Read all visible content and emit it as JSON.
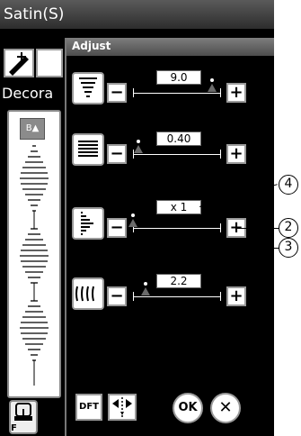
{
  "window": {
    "title": "Satin(S)"
  },
  "background": {
    "side_label": "Decora"
  },
  "panel": {
    "title": "Adjust",
    "rows": [
      {
        "name": "width",
        "value": "9.0",
        "position": 0.9
      },
      {
        "name": "density",
        "value": "0.40",
        "position": 0.05
      },
      {
        "name": "elongation",
        "value": "x 1",
        "position": 0.0
      },
      {
        "name": "length",
        "value": "2.2",
        "position": 0.15
      }
    ]
  },
  "buttons": {
    "minus_label": "−",
    "plus_label": "+",
    "dft_label": "DFT",
    "ok_label": "OK",
    "cancel_label": "✕",
    "foot_label": "F"
  },
  "callouts": [
    "4",
    "2",
    "3"
  ],
  "icons": {
    "width": "width-icon",
    "density": "density-icon",
    "elongation": "elongation-icon",
    "length": "stitch-length-icon"
  }
}
